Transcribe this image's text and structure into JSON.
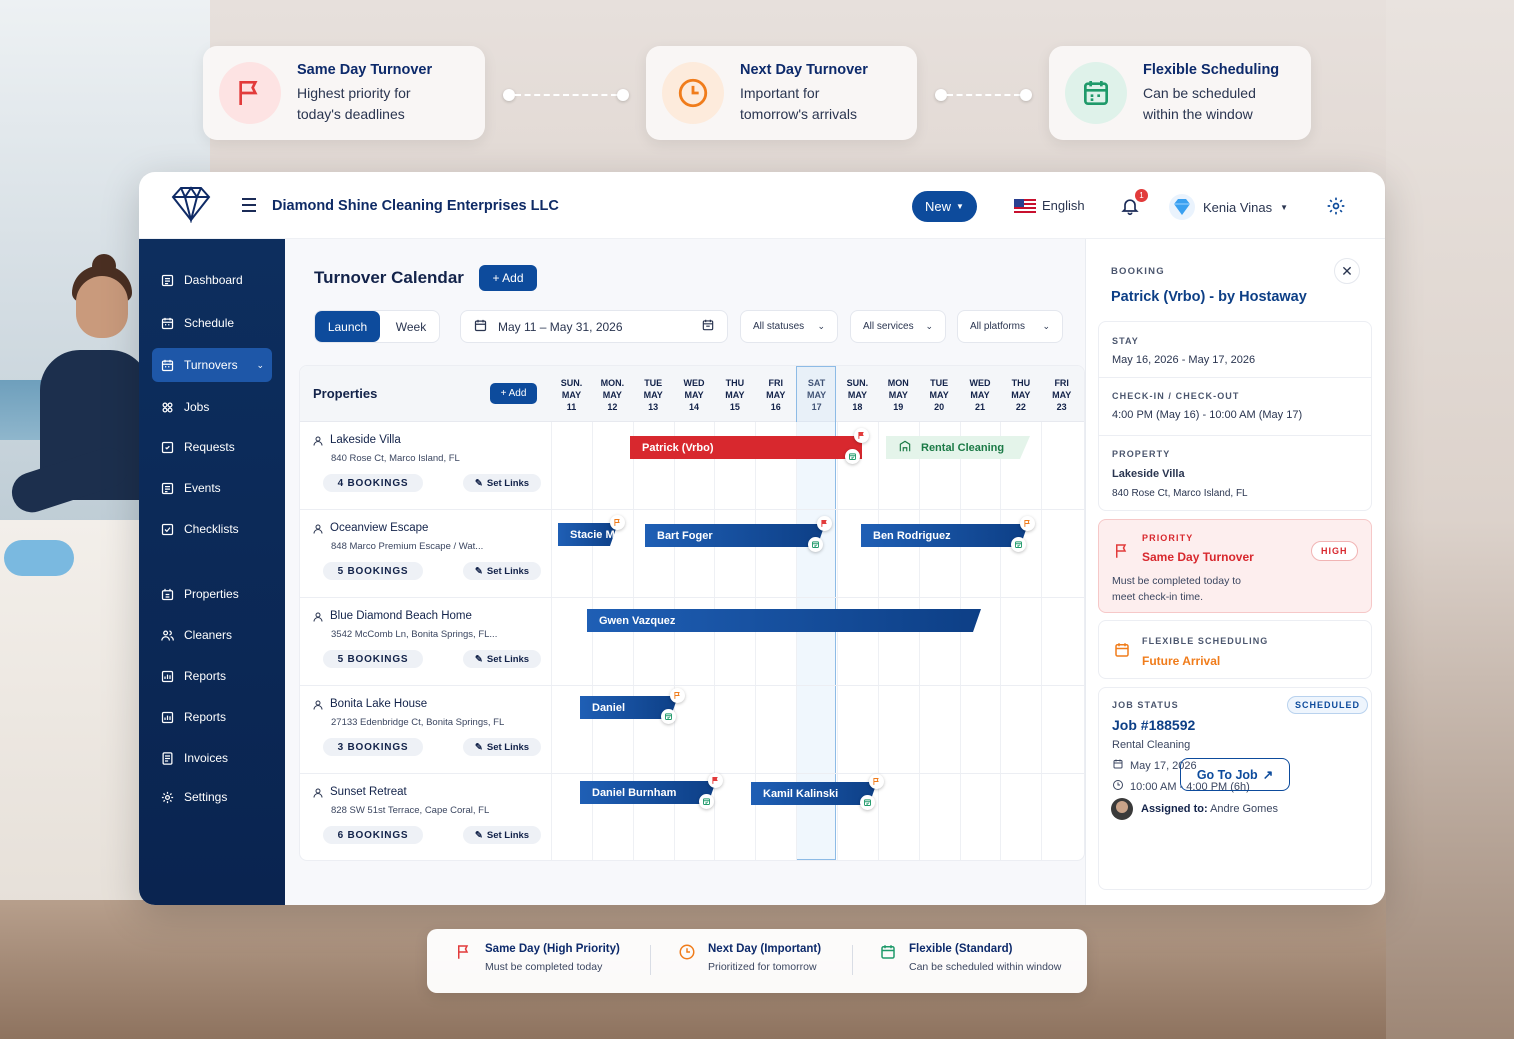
{
  "top_cards": [
    {
      "title": "Same Day Turnover",
      "line1": "Highest priority for",
      "line2": "today's deadlines",
      "icon": "flag-icon",
      "color": "#e23b3b"
    },
    {
      "title": "Next Day Turnover",
      "line1": "Important for",
      "line2": "tomorrow's arrivals",
      "icon": "clock-icon",
      "color": "#f07c1b"
    },
    {
      "title": "Flexible Scheduling",
      "line1": "Can be scheduled",
      "line2": "within the window",
      "icon": "calendar-icon",
      "color": "#1f9a6a"
    }
  ],
  "header": {
    "company": "Diamond Shine Cleaning Enterprises LLC",
    "new_label": "New",
    "language": "English",
    "notifications": "1",
    "user_name": "Kenia Vinas"
  },
  "sidebar": {
    "items": [
      {
        "label": "Dashboard",
        "icon": "dashboard-icon"
      },
      {
        "label": "Schedule",
        "icon": "calendar-icon"
      },
      {
        "label": "Turnovers",
        "icon": "calendar-icon",
        "active": true
      },
      {
        "label": "Jobs",
        "icon": "jobs-icon"
      },
      {
        "label": "Requests",
        "icon": "requests-icon"
      },
      {
        "label": "Events",
        "icon": "events-icon"
      },
      {
        "label": "Checklists",
        "icon": "checklist-icon"
      },
      {
        "label": "Properties",
        "icon": "properties-icon"
      },
      {
        "label": "Cleaners",
        "icon": "cleaners-icon"
      },
      {
        "label": "Reports",
        "icon": "reports-icon"
      },
      {
        "label": "Reports",
        "icon": "reports-icon"
      },
      {
        "label": "Invoices",
        "icon": "invoices-icon"
      },
      {
        "label": "Settings",
        "icon": "gear-icon"
      }
    ]
  },
  "calendar": {
    "title": "Turnover Calendar",
    "add_label": "+ Add",
    "view_launch": "Launch",
    "view_week": "Week",
    "date_range": "May 11 – May 31, 2026",
    "filter_status": "All statuses",
    "filter_services": "All services",
    "filter_platforms": "All platforms",
    "properties_header": "Properties",
    "properties_add": "+ Add",
    "set_links_label": "Set Links",
    "days": [
      {
        "dow": "SUN.",
        "mon": "MAY",
        "d": "11"
      },
      {
        "dow": "MON.",
        "mon": "MAY",
        "d": "12"
      },
      {
        "dow": "TUE",
        "mon": "MAY",
        "d": "13"
      },
      {
        "dow": "WED",
        "mon": "MAY",
        "d": "14"
      },
      {
        "dow": "THU",
        "mon": "MAY",
        "d": "15"
      },
      {
        "dow": "FRI",
        "mon": "MAY",
        "d": "16"
      },
      {
        "dow": "SAT",
        "mon": "MAY",
        "d": "17"
      },
      {
        "dow": "SUN.",
        "mon": "MAY",
        "d": "18"
      },
      {
        "dow": "MON",
        "mon": "MAY",
        "d": "19"
      },
      {
        "dow": "TUE",
        "mon": "MAY",
        "d": "20"
      },
      {
        "dow": "WED",
        "mon": "MAY",
        "d": "21"
      },
      {
        "dow": "THU",
        "mon": "MAY",
        "d": "22"
      },
      {
        "dow": "FRI",
        "mon": "MAY",
        "d": "23"
      }
    ],
    "properties": [
      {
        "name": "Lakeside Villa",
        "address": "840 Rose Ct, Marco Island, FL",
        "bookings": "4 BOOKINGS"
      },
      {
        "name": "Oceanview Escape",
        "address": "848 Marco Premium Escape / Wat...",
        "bookings": "5 BOOKINGS"
      },
      {
        "name": "Blue Diamond Beach Home",
        "address": "3542 McComb Ln, Bonita Springs, FL...",
        "bookings": "5 BOOKINGS"
      },
      {
        "name": "Bonita Lake House",
        "address": "27133 Edenbridge Ct, Bonita Springs, FL",
        "bookings": "3 BOOKINGS"
      },
      {
        "name": "Sunset Retreat",
        "address": "828 SW 51st Terrace, Cape Coral, FL",
        "bookings": "6 BOOKINGS"
      }
    ],
    "bookings": {
      "patrick": "Patrick (Vrbo)",
      "rental": "Rental Cleaning",
      "stacie": "Stacie M.",
      "bart": "Bart Foger",
      "ben": "Ben Rodriguez",
      "gwen": "Gwen Vazquez",
      "daniel": "Daniel",
      "daniel_b": "Daniel Burnham",
      "kamil": "Kamil Kalinski"
    }
  },
  "panel": {
    "label": "BOOKING",
    "title": "Patrick (Vrbo) - by Hostaway",
    "stay_label": "STAY",
    "stay_value": "May 16, 2026 - May 17, 2026",
    "checkin_label": "CHECK-IN / CHECK-OUT",
    "checkin_value": "4:00 PM (May 16) - 10:00 AM (May 17)",
    "property_label": "PROPERTY",
    "property_name": "Lakeside Villa",
    "property_address": "840 Rose Ct, Marco Island, FL",
    "priority_label": "PRIORITY",
    "priority_value": "Same Day Turnover",
    "priority_badge": "HIGH",
    "priority_desc1": "Must be completed today to",
    "priority_desc2": "meet check-in time.",
    "flex_label": "FLEXIBLE SCHEDULING",
    "flex_value": "Future Arrival",
    "job_status_label": "JOB STATUS",
    "job_status_badge": "SCHEDULED",
    "job_id": "Job #188592",
    "job_type": "Rental Cleaning",
    "job_date": "May 17, 2026",
    "job_time": "10:00 AM - 4:00 PM (6h)",
    "assigned_label": "Assigned to:",
    "assigned_name": "Andre Gomes",
    "go_to_job": "Go To Job"
  },
  "legend": [
    {
      "title": "Same Day (High Priority)",
      "desc": "Must be completed today",
      "icon": "flag-icon",
      "color": "#e23b3b"
    },
    {
      "title": "Next Day (Important)",
      "desc": "Prioritized for tomorrow",
      "icon": "clock-icon",
      "color": "#f07c1b"
    },
    {
      "title": "Flexible (Standard)",
      "desc": "Can be scheduled within window",
      "icon": "calendar-icon",
      "color": "#1f9a6a"
    }
  ]
}
